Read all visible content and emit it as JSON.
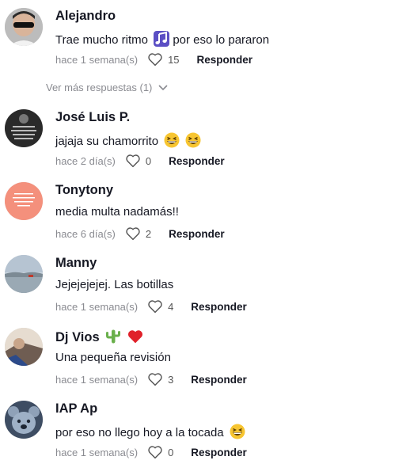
{
  "comments": [
    {
      "username": "Alejandro",
      "text": "Trae mucho ritmo",
      "text_after": "por eso lo pararon",
      "time": "hace 1 semana(s)",
      "likes": "15",
      "reply": "Responder"
    },
    {
      "username": "José Luis P.",
      "text": "jajaja su chamorrito",
      "time": "hace 2 día(s)",
      "likes": "0",
      "reply": "Responder"
    },
    {
      "username": "Tonytony",
      "text": "media multa nadamás!!",
      "time": "hace 6 día(s)",
      "likes": "2",
      "reply": "Responder"
    },
    {
      "username": "Manny",
      "text": "Jejejejejej. Las botillas",
      "time": "hace 1 semana(s)",
      "likes": "4",
      "reply": "Responder"
    },
    {
      "username": "Dj Vios",
      "text": "Una pequeña revisión",
      "time": "hace 1 semana(s)",
      "likes": "3",
      "reply": "Responder"
    },
    {
      "username": "IAP Ap",
      "text": "por eso no llego hoy a la tocada",
      "time": "hace 1 semana(s)",
      "likes": "0",
      "reply": "Responder"
    }
  ],
  "view_more": {
    "label": "Ver más respuestas (1)"
  },
  "colors": {
    "text": "#161823",
    "muted": "#8a8b91",
    "avatar_tony": "#f4907c"
  },
  "icons": {
    "like": "heart-outline-icon",
    "expand": "chevron-down-icon",
    "music": "music-note-emoji",
    "laugh": "grinning-squint-emoji",
    "cactus": "cactus-emoji",
    "heart": "red-heart-emoji"
  }
}
